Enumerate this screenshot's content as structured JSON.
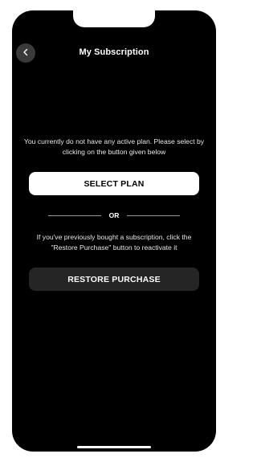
{
  "header": {
    "title": "My Subscription",
    "back_icon": "chevron-left-icon"
  },
  "no_plan": {
    "message": "You currently do not have any active plan. Please select by clicking on the button given below",
    "select_plan_label": "SELECT PLAN"
  },
  "divider": {
    "label": "OR"
  },
  "restore": {
    "message": "If you've previously bought a subscription, click the \"Restore Purchase\" button to reactivate it",
    "restore_label": "RESTORE PURCHASE"
  },
  "colors": {
    "background": "#000000",
    "primary_button": "#ffffff",
    "secondary_button": "#252525",
    "back_button": "#3a3a3a"
  }
}
